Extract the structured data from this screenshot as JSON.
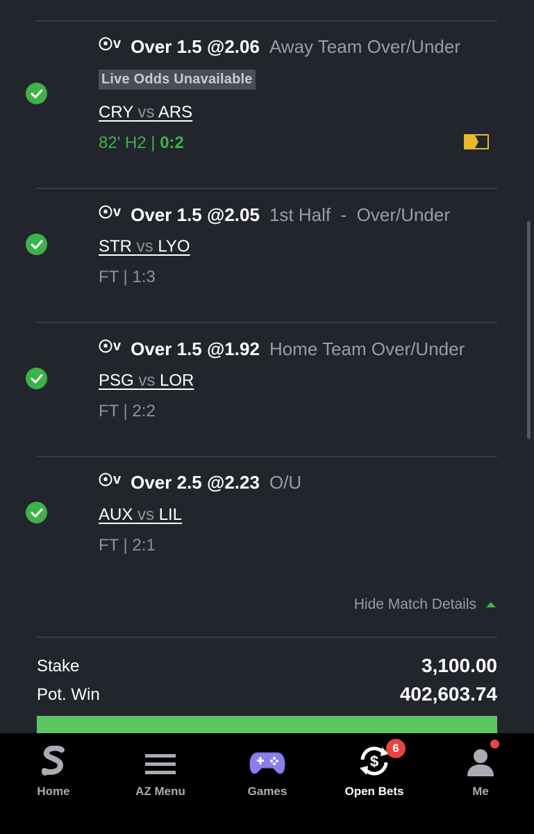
{
  "bets": [
    {
      "sport": "v",
      "pick": "Over 1.5 @2.06",
      "market": "Away Team Over/Under",
      "live_odds_note": "Live Odds Unavailable",
      "home": "CRY",
      "vs": "vs",
      "away": "ARS",
      "status_prefix": "82' H2 | ",
      "status_score": "0:2",
      "live": true
    },
    {
      "sport": "v",
      "pick": "Over 1.5 @2.05",
      "market": "1st Half  -  Over/Under",
      "home": "STR",
      "vs": "vs",
      "away": "LYO",
      "status": "FT | 1:3"
    },
    {
      "sport": "v",
      "pick": "Over 1.5 @1.92",
      "market": "Home Team Over/Under",
      "home": "PSG",
      "vs": "vs",
      "away": "LOR",
      "status": "FT | 2:2"
    },
    {
      "sport": "v",
      "pick": "Over 2.5 @2.23",
      "market": "O/U",
      "home": "AUX",
      "vs": "vs",
      "away": "LIL",
      "status": "FT | 2:1"
    }
  ],
  "details_toggle": "Hide Match Details",
  "summary": {
    "stake_label": "Stake",
    "stake_value": "3,100.00",
    "pot_win_label": "Pot. Win",
    "pot_win_value": "402,603.74"
  },
  "nav": {
    "items": [
      {
        "label": "Home",
        "icon": "sportybet-logo-icon"
      },
      {
        "label": "AZ Menu",
        "icon": "menu-icon"
      },
      {
        "label": "Games",
        "icon": "gamepad-icon"
      },
      {
        "label": "Open Bets",
        "icon": "open-bets-icon",
        "badge": "6"
      },
      {
        "label": "Me",
        "icon": "user-icon"
      }
    ]
  },
  "colors": {
    "background": "#22252c",
    "accent_green": "#3fb14a",
    "badge_red": "#e5463f",
    "tv_yellow": "#e8b92a"
  }
}
